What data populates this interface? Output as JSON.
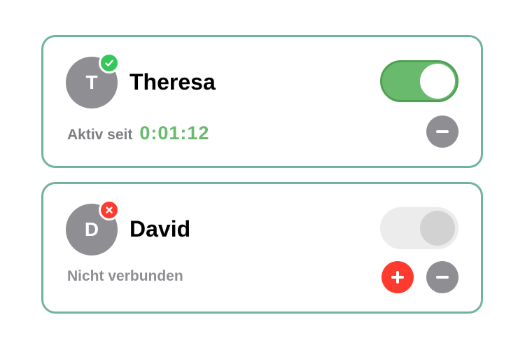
{
  "connections": [
    {
      "avatar_initial": "T",
      "name": "Theresa",
      "status_icon": "checkmark-icon",
      "toggle_on": true,
      "status_label": "Aktiv seit",
      "timer": "0:01:12"
    },
    {
      "avatar_initial": "D",
      "name": "David",
      "status_icon": "cross-icon",
      "toggle_on": false,
      "status_label": "Nicht verbunden"
    }
  ],
  "colors": {
    "card_border": "#6fb3a0",
    "active_green": "#6aba6e",
    "badge_green": "#34c759",
    "badge_red": "#ff3b30",
    "neutral_gray": "#8e8e93"
  }
}
